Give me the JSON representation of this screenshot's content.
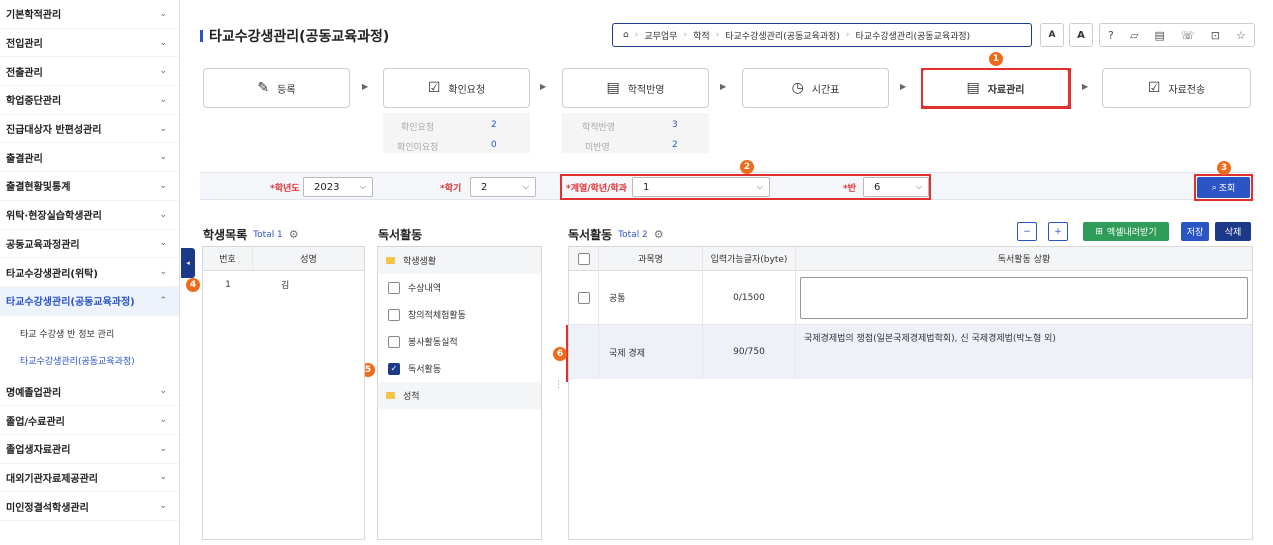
{
  "sidebar": {
    "items": [
      {
        "label": "기본학적관리"
      },
      {
        "label": "전입관리"
      },
      {
        "label": "전출관리"
      },
      {
        "label": "학업중단관리"
      },
      {
        "label": "진급대상자 반편성관리"
      },
      {
        "label": "출결관리"
      },
      {
        "label": "출결현황및통계"
      },
      {
        "label": "위탁·현장실습학생관리"
      },
      {
        "label": "공동교육과정관리"
      },
      {
        "label": "타교수강생관리(위탁)"
      },
      {
        "label": "타교수강생관리(공동교육과정)"
      }
    ],
    "sub_items": [
      {
        "label": "타교 수강생 반 정보 관리"
      },
      {
        "label": "타교수강생관리(공동교육과정)"
      }
    ],
    "items_after": [
      {
        "label": "명예졸업관리"
      },
      {
        "label": "졸업/수료관리"
      },
      {
        "label": "졸업생자료관리"
      },
      {
        "label": "대외기관자료제공관리"
      },
      {
        "label": "미인정결석학생관리"
      }
    ],
    "collapse_glyph": "◂"
  },
  "header": {
    "title": "타교수강생관리(공동교육과정)",
    "breadcrumb": [
      "교무업무",
      "학적",
      "타교수강생관리(공동교육과정)",
      "타교수강생관리(공동교육과정)"
    ],
    "font_small": "A",
    "font_large": "A"
  },
  "steps": [
    {
      "label": "등록"
    },
    {
      "label": "확인요청"
    },
    {
      "label": "학적반영"
    },
    {
      "label": "시간표"
    },
    {
      "label": "자료관리"
    },
    {
      "label": "자료전송"
    }
  ],
  "stats": {
    "confirm_request_label": "확인요청",
    "confirm_request_value": "2",
    "unconfirmed_label": "확인미요청",
    "unconfirmed_value": "0",
    "reflected_label": "학적반영",
    "reflected_value": "3",
    "unreflected_label": "미반영",
    "unreflected_value": "2"
  },
  "markers": [
    "1",
    "2",
    "3",
    "4",
    "5",
    "6"
  ],
  "filters": {
    "year_label": "*학년도",
    "year_value": "2023",
    "semester_label": "*학기",
    "semester_value": "2",
    "major_label": "*계열/학년/학과",
    "major_value": "1",
    "class_label": "*반",
    "class_value": "6",
    "search_label": "조회"
  },
  "students": {
    "title": "학생목록",
    "total": "Total 1",
    "col_no": "번호",
    "col_name": "성명",
    "rows": [
      {
        "no": "1",
        "name": "김"
      }
    ]
  },
  "reading_tree": {
    "title": "독서활동",
    "root": "학생생활",
    "items": [
      {
        "label": "수상내역",
        "checked": false
      },
      {
        "label": "창의적체험활동",
        "checked": false
      },
      {
        "label": "봉사활동실적",
        "checked": false
      },
      {
        "label": "독서활동",
        "checked": true
      }
    ],
    "grades": "성적"
  },
  "reading_table": {
    "title": "독서활동",
    "total": "Total 2",
    "col_subject": "과목명",
    "col_limit": "입력가능글자(byte)",
    "col_content": "독서활동 상황",
    "rows": [
      {
        "subject": "공통",
        "limit": "0/1500",
        "content": ""
      },
      {
        "subject": "국제 경제",
        "limit": "90/750",
        "content": "국제경제법의 쟁점(일본국제경제법학회), 신 국제경제법(박노형 외)"
      }
    ],
    "btn_minus": "−",
    "btn_plus": "+",
    "btn_excel": "엑셀내려받기",
    "btn_save": "저장",
    "btn_delete": "삭제"
  },
  "colors": {
    "accent": "#2b55c5",
    "highlight_border": "#e03030",
    "marker": "#f06a1b",
    "excel_green": "#2f9c5a",
    "delete_navy": "#1d3a8a"
  }
}
